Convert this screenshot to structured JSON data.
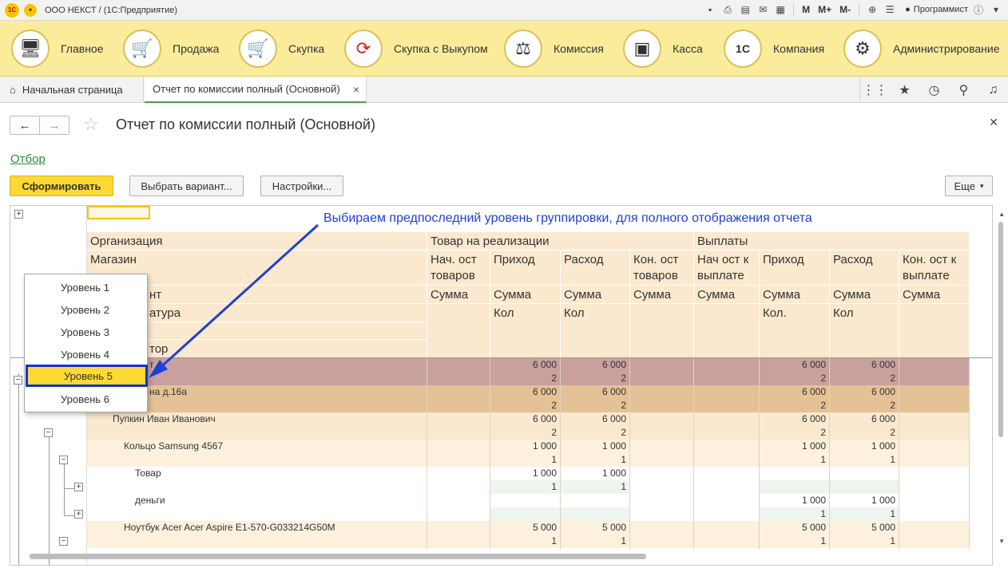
{
  "window": {
    "title": "ООО НЕКСТ / (1С:Предприятие)",
    "user": "Программист",
    "memory_buttons": [
      "M",
      "M+",
      "M-"
    ]
  },
  "sections": [
    {
      "label": "Главное",
      "icon": "computer-icon"
    },
    {
      "label": "Продажа",
      "icon": "cart-up-icon"
    },
    {
      "label": "Скупка",
      "icon": "cart-down-icon"
    },
    {
      "label": "Скупка с Выкупом",
      "icon": "cycle-arrows-icon"
    },
    {
      "label": "Комиссия",
      "icon": "scales-icon"
    },
    {
      "label": "Касса",
      "icon": "cash-register-icon"
    },
    {
      "label": "Компания",
      "icon": "company-logo-icon"
    },
    {
      "label": "Администрирование",
      "icon": "gears-icon"
    }
  ],
  "tabs": {
    "home": "Начальная страница",
    "active": "Отчет по комиссии полный (Основной)"
  },
  "form": {
    "title": "Отчет по комиссии полный (Основной)",
    "filter_link": "Отбор",
    "generate_button": "Сформировать",
    "variant_button": "Выбрать вариант...",
    "settings_button": "Настройки...",
    "more_button": "Еще"
  },
  "annotation": "Выбираем предпоследний уровень группировки, для полного отображения отчета",
  "report": {
    "headers": {
      "col1": [
        "Организация",
        "Магазин",
        "нт",
        "атура",
        "тор"
      ],
      "goods_group": "Товар на реализации",
      "payments_group": "Выплаты",
      "goods_cols": [
        "Нач. ост товаров",
        "Приход",
        "Расход",
        "Кон. ост товаров"
      ],
      "payments_cols": [
        "Нач ост к выплате",
        "Приход",
        "Расход",
        "Кон. ост к выплате"
      ],
      "sum_row": [
        "Сумма",
        "Сумма",
        "Сумма",
        "Сумма",
        "Сумма",
        "Сумма",
        "Сумма",
        "Сумма"
      ],
      "qty_row": [
        "Кол",
        "Кол",
        "Кол.",
        "Кол"
      ]
    },
    "rows": [
      {
        "name": "т",
        "goods_in": [
          "6 000",
          "2"
        ],
        "goods_out": [
          "6 000",
          "2"
        ],
        "pay_in": [
          "6 000",
          "2"
        ],
        "pay_out": [
          "6 000",
          "2"
        ]
      },
      {
        "name": "на д.16а",
        "goods_in": [
          "6 000",
          "2"
        ],
        "goods_out": [
          "6 000",
          "2"
        ],
        "pay_in": [
          "6 000",
          "2"
        ],
        "pay_out": [
          "6 000",
          "2"
        ]
      },
      {
        "name": "Пупкин Иван Иванович",
        "goods_in": [
          "6 000",
          "2"
        ],
        "goods_out": [
          "6 000",
          "2"
        ],
        "pay_in": [
          "6 000",
          "2"
        ],
        "pay_out": [
          "6 000",
          "2"
        ]
      },
      {
        "name": "Кольцо Samsung 4567",
        "goods_in": [
          "1 000",
          "1"
        ],
        "goods_out": [
          "1 000",
          "1"
        ],
        "pay_in": [
          "1 000",
          "1"
        ],
        "pay_out": [
          "1 000",
          "1"
        ]
      },
      {
        "name": "Товар",
        "goods_in": [
          "1 000",
          "1"
        ],
        "goods_out": [
          "1 000",
          "1"
        ],
        "pay_in": [
          "",
          ""
        ],
        "pay_out": [
          "",
          ""
        ]
      },
      {
        "name": "деньги",
        "goods_in": [
          "",
          ""
        ],
        "goods_out": [
          "",
          ""
        ],
        "pay_in": [
          "1 000",
          "1"
        ],
        "pay_out": [
          "1 000",
          "1"
        ]
      },
      {
        "name": "Ноутбук Acer Acer Aspire E1-570-G033214G50M",
        "goods_in": [
          "5 000",
          "1"
        ],
        "goods_out": [
          "5 000",
          "1"
        ],
        "pay_in": [
          "5 000",
          "1"
        ],
        "pay_out": [
          "5 000",
          "1"
        ]
      }
    ]
  },
  "levels_menu": [
    "Уровень 1",
    "Уровень 2",
    "Уровень 3",
    "Уровень 4",
    "Уровень 5",
    "Уровень 6"
  ],
  "levels_selected": "Уровень 5",
  "colors": {
    "section_bar": "#fbec9c",
    "header_fill": "#fbe9cf",
    "row_level1": "#c8a09d",
    "row_level2": "#e5c295",
    "row_level3": "#fbe9cf",
    "highlight_border": "#1133cc",
    "annotation": "#1f3fd6"
  }
}
